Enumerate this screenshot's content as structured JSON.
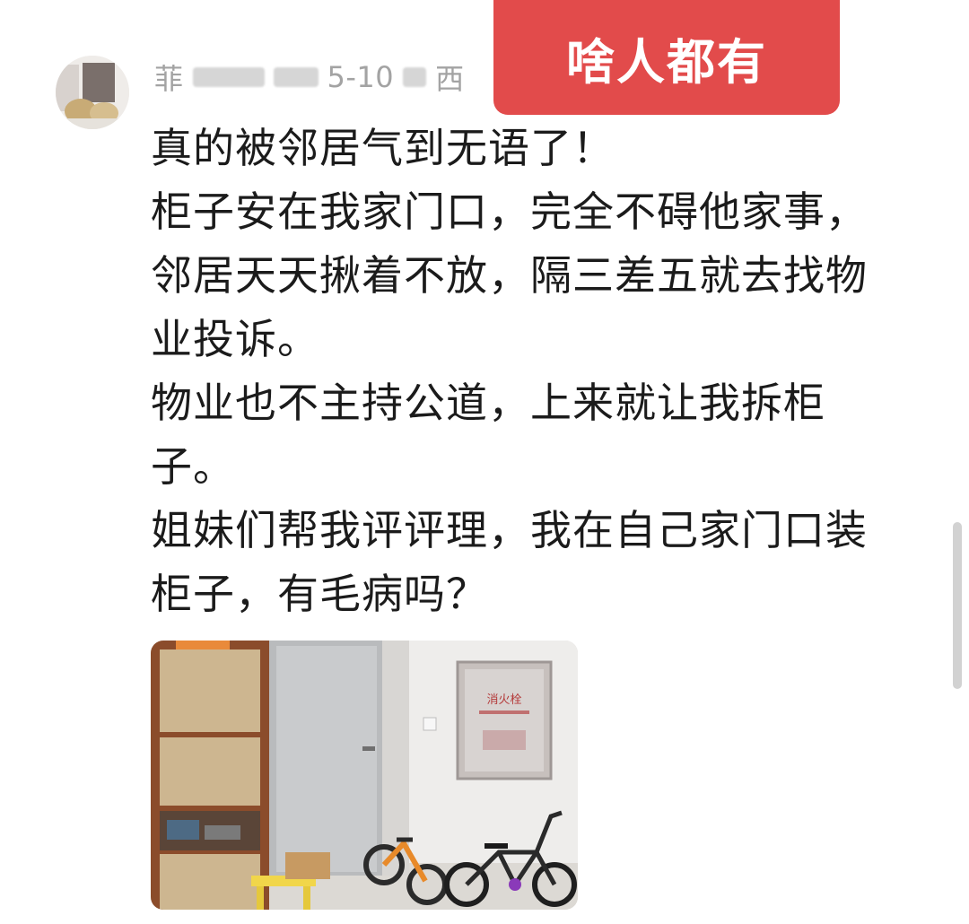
{
  "tag": {
    "label": "啥人都有"
  },
  "comment": {
    "username": "菲",
    "date": "5-10",
    "location": "西",
    "lines": [
      "真的被邻居气到无语了！",
      "柜子安在我家门口，完全不碍他家事，",
      "邻居天天揪着不放，隔三差五就去找物",
      "业投诉。",
      "物业也不主持公道，上来就让我拆柜",
      "子。",
      "姐妹们帮我评评理，我在自己家门口装",
      "柜子，有毛病吗？"
    ],
    "photo_sign": "消火栓"
  }
}
